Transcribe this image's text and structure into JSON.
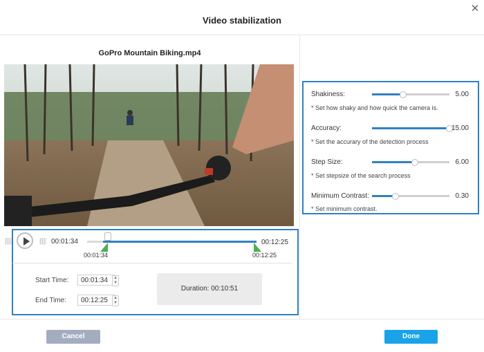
{
  "dialog": {
    "title": "Video stabilization"
  },
  "video": {
    "filename": "GoPro Mountain Biking.mp4"
  },
  "player": {
    "current_time": "00:01:34",
    "end_time": "00:12:25",
    "marker_start": "00:01:34",
    "marker_end": "00:12:25"
  },
  "trim": {
    "start_label": "Start Time:",
    "start_value": "00:01:34",
    "end_label": "End Time:",
    "end_value": "00:12:25",
    "duration_label": "Duration:",
    "duration_value": "00:10:51"
  },
  "settings": [
    {
      "label": "Shakiness:",
      "value": "5.00",
      "hint": "* Set how shaky and how quick the camera is.",
      "fraction": 0.4
    },
    {
      "label": "Accuracy:",
      "value": "15.00",
      "hint": "* Set the accurary of the detection process",
      "fraction": 1.0
    },
    {
      "label": "Step Size:",
      "value": "6.00",
      "hint": "* Set stepsize of the search process",
      "fraction": 0.55
    },
    {
      "label": "Minimum Contrast:",
      "value": "0.30",
      "hint": "* Set minimum contrast.",
      "fraction": 0.3
    }
  ],
  "buttons": {
    "cancel": "Cancel",
    "done": "Done"
  },
  "colors": {
    "accent": "#2f80c2",
    "done": "#1aa3e8",
    "cancel": "#a3adbf",
    "marker": "#4caf50"
  }
}
